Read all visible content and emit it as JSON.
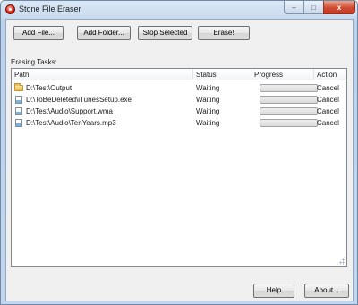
{
  "window": {
    "title": "Stone File Eraser",
    "caption_buttons": {
      "minimize": "–",
      "maximize": "□",
      "close": "x"
    }
  },
  "toolbar": {
    "add_file": "Add File...",
    "add_folder": "Add Folder...",
    "stop_selected": "Stop Selected",
    "erase": "Erase!"
  },
  "tasks": {
    "label": "Erasing Tasks:",
    "columns": [
      "Path",
      "Status",
      "Progress",
      "Action"
    ],
    "rows": [
      {
        "icon": "folder-icon",
        "path": "D:\\Test\\Output",
        "status": "Waiting",
        "progress": 0,
        "action": "Cancel"
      },
      {
        "icon": "file-icon",
        "path": "D:\\ToBeDeleted\\iTunesSetup.exe",
        "status": "Waiting",
        "progress": 0,
        "action": "Cancel"
      },
      {
        "icon": "file-icon",
        "path": "D:\\Test\\Audio\\Support.wma",
        "status": "Waiting",
        "progress": 0,
        "action": "Cancel"
      },
      {
        "icon": "file-icon",
        "path": "D:\\Test\\Audio\\TenYears.mp3",
        "status": "Waiting",
        "progress": 0,
        "action": "Cancel"
      }
    ]
  },
  "footer": {
    "help": "Help",
    "about": "About..."
  }
}
